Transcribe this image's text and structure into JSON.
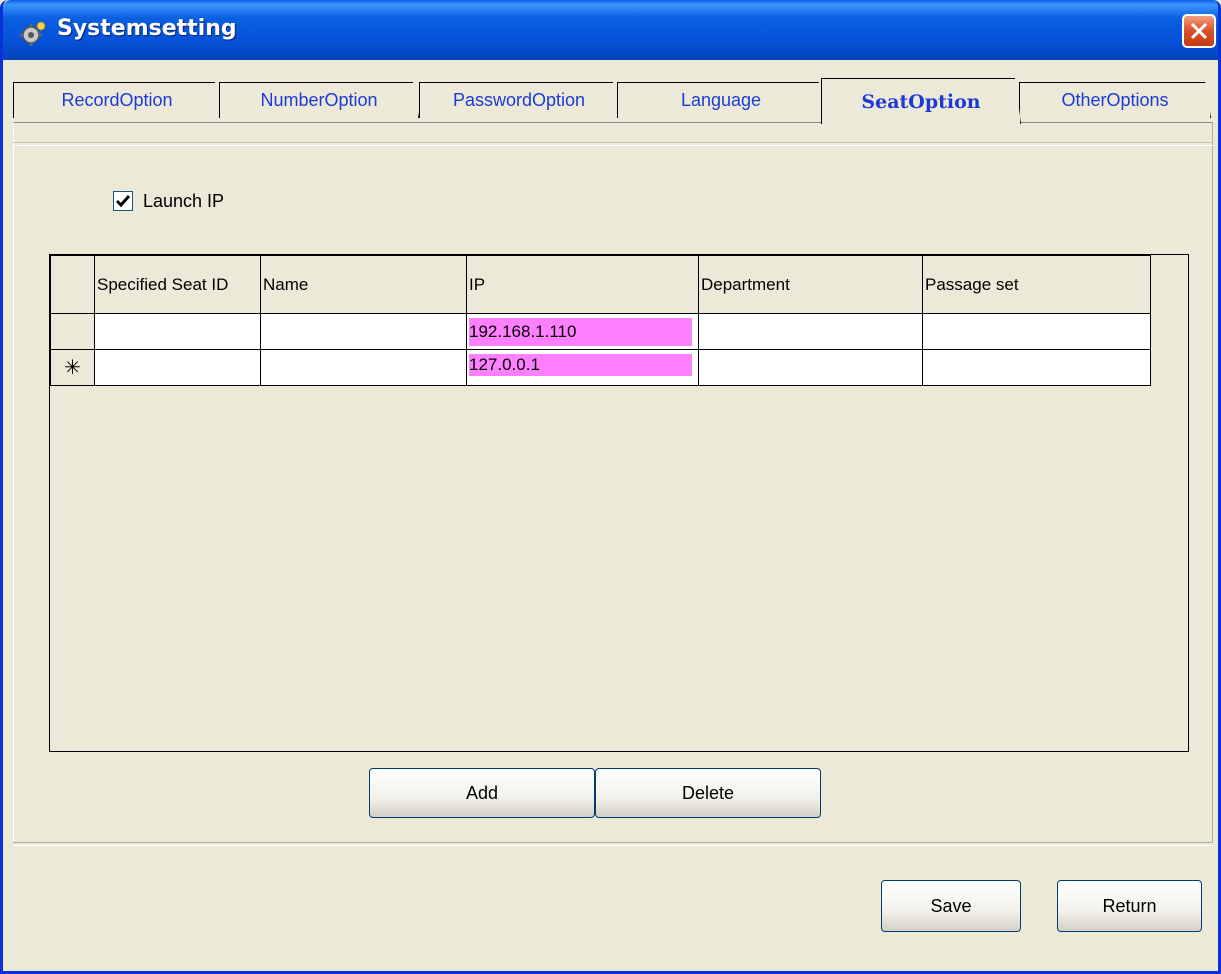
{
  "window": {
    "title": "Systemsetting",
    "icon": "gear-icon",
    "close_icon": "close-icon"
  },
  "tabs": [
    {
      "label": "RecordOption",
      "active": false
    },
    {
      "label": "NumberOption",
      "active": false
    },
    {
      "label": "PasswordOption",
      "active": false
    },
    {
      "label": "Language",
      "active": false
    },
    {
      "label": "SeatOption",
      "active": true
    },
    {
      "label": "OtherOptions",
      "active": false
    }
  ],
  "launch_ip": {
    "label": "Launch IP",
    "checked": true
  },
  "grid": {
    "columns": [
      "Specified Seat ID",
      "Name",
      "IP",
      "Department",
      "Passage set"
    ],
    "rows": [
      {
        "marker": "",
        "cells": [
          "",
          "",
          "192.168.1.110",
          "",
          ""
        ]
      },
      {
        "marker": "✳",
        "cells": [
          "",
          "",
          "127.0.0.1",
          "",
          ""
        ]
      }
    ]
  },
  "buttons": {
    "add": "Add",
    "delete": "Delete",
    "save": "Save",
    "return": "Return"
  },
  "colors": {
    "title_bar": "#0a5fe0",
    "highlight": "#ff80ff",
    "tab_text": "#1c3bd6",
    "panel": "#ece9d8"
  }
}
